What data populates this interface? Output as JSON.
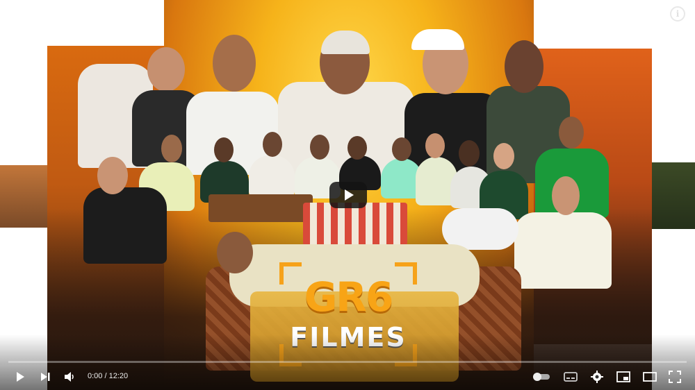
{
  "video": {
    "title_logo_top": "GR6",
    "title_logo_bottom": "FILMES",
    "current_time": "0:00",
    "duration": "12:20",
    "time_display": "0:00 / 12:20",
    "progress_fraction": 0.0
  },
  "icons": {
    "info": "info-icon",
    "big_play": "play-icon",
    "play": "play-icon",
    "next": "next-icon",
    "volume": "volume-icon",
    "autoplay": "autoplay-toggle-icon",
    "subtitles": "subtitles-icon",
    "settings": "gear-icon",
    "miniplayer": "miniplayer-icon",
    "theater": "theater-mode-icon",
    "fullscreen": "fullscreen-icon"
  },
  "info_glyph": "i",
  "colors": {
    "accent": "#f8a416",
    "progress": "#ff0000"
  }
}
